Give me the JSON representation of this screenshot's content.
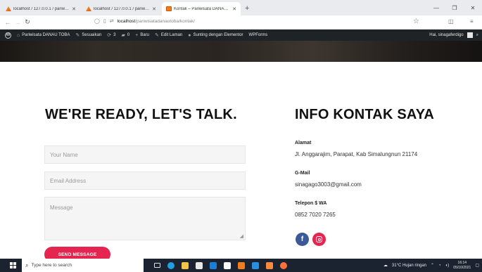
{
  "browser": {
    "tabs": [
      {
        "title": "localhost / 127.0.0.1 / pariwisata",
        "icon": "xampp-icon",
        "active": false
      },
      {
        "title": "localhost / 127.0.0.1 / pariwisata",
        "icon": "xampp-icon",
        "active": false
      },
      {
        "title": "Kontak – Pariwisata DANAU TOBA",
        "icon": "site-icon",
        "active": true
      }
    ],
    "new_tab_label": "+",
    "url_host": "localhost",
    "url_path": "/pariwisatadanautoba/kontak/"
  },
  "wp_admin_bar": {
    "site_name": "Pariwisata DANAU TOBA",
    "customize": "Sesuaikan",
    "updates_count": "3",
    "comments_count": "0",
    "new_label": "Baru",
    "edit_page": "Edit Laman",
    "elementor": "Sunting dengan Elementor",
    "wpforms": "WPForms",
    "greeting": "Hai, sinagaferdigo"
  },
  "contact": {
    "heading_left": "WE'RE READY, LET'S TALK.",
    "heading_right": "INFO KONTAK SAYA",
    "name_placeholder": "Your Name",
    "email_placeholder": "Email Address",
    "message_placeholder": "Message",
    "send_label": "SEND MESSAGE",
    "info": [
      {
        "label": "Alamat",
        "value": "Jl. Anggarajim, Parapat, Kab Simalungnun 21174"
      },
      {
        "label": "G-Mail",
        "value": "sinagago3003@gmail.com"
      },
      {
        "label": "Telepon $ WA",
        "value": "0852 7020 7265"
      }
    ],
    "social": [
      "facebook-icon",
      "instagram-icon"
    ],
    "colors": {
      "accent": "#e4254f",
      "facebook": "#3b5998"
    }
  },
  "taskbar": {
    "search_placeholder": "Type here to search",
    "weather": "31°C  Hujan ringan",
    "time": "16:14",
    "date": "05/10/2021"
  }
}
